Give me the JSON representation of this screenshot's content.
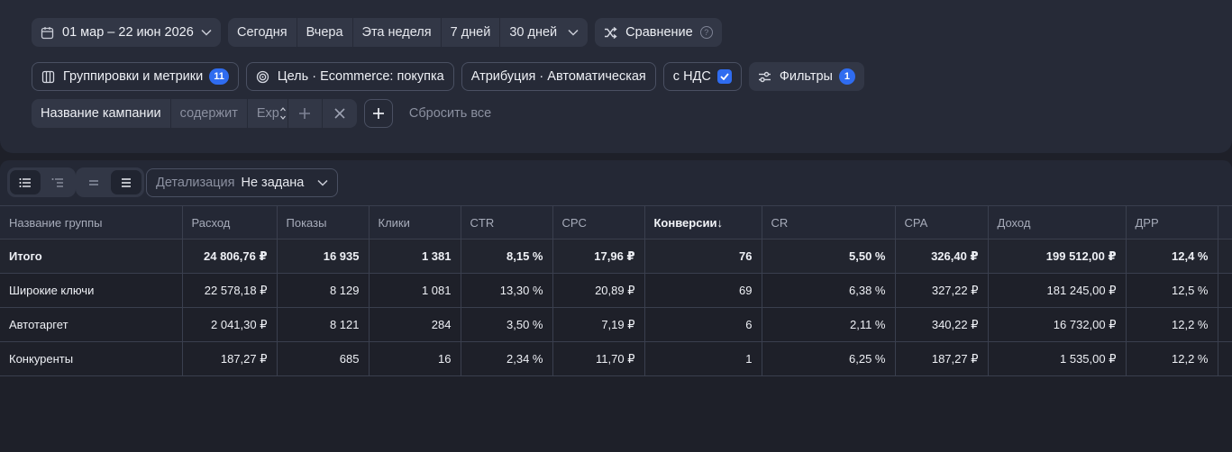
{
  "date_range": {
    "label": "01 мар – 22 июн 2026"
  },
  "periods": [
    "Сегодня",
    "Вчера",
    "Эта неделя",
    "7 дней",
    "30 дней"
  ],
  "compare": {
    "label": "Сравнение",
    "help": "?"
  },
  "groupings": {
    "label": "Группировки и метрики",
    "count": "11"
  },
  "goal": {
    "label": "Цель · Ecommerce: покупка"
  },
  "attribution": {
    "label": "Атрибуция · Автоматическая"
  },
  "vat": {
    "label": "с НДС",
    "checked": true
  },
  "filters": {
    "label": "Фильтры",
    "count": "1"
  },
  "filter_condition": {
    "field": "Название кампании",
    "operator": "содержит",
    "value": "Exp"
  },
  "reset_all": "Сбросить все",
  "detail": {
    "label": "Детализация",
    "value": "Не задана"
  },
  "table": {
    "columns": [
      "Название группы",
      "Расход",
      "Показы",
      "Клики",
      "CTR",
      "CPC",
      "Конверсии",
      "CR",
      "CPA",
      "Доход",
      "ДРР"
    ],
    "sort_arrow": "↓",
    "rows": [
      [
        "Итого",
        "24 806,76 ₽",
        "16 935",
        "1 381",
        "8,15 %",
        "17,96 ₽",
        "76",
        "5,50 %",
        "326,40 ₽",
        "199 512,00 ₽",
        "12,4 %"
      ],
      [
        "Широкие ключи",
        "22 578,18 ₽",
        "8 129",
        "1 081",
        "13,30 %",
        "20,89 ₽",
        "69",
        "6,38 %",
        "327,22 ₽",
        "181 245,00 ₽",
        "12,5 %"
      ],
      [
        "Автотаргет",
        "2 041,30 ₽",
        "8 121",
        "284",
        "3,50 %",
        "7,19 ₽",
        "6",
        "2,11 %",
        "340,22 ₽",
        "16 732,00 ₽",
        "12,2 %"
      ],
      [
        "Конкуренты",
        "187,27 ₽",
        "685",
        "16",
        "2,34 %",
        "11,70 ₽",
        "1",
        "6,25 %",
        "187,27 ₽",
        "1 535,00 ₽",
        "12,2 %"
      ]
    ]
  },
  "colors": {
    "accent": "#2f6cf0",
    "background": "#1e2029",
    "panel": "#262a37"
  }
}
